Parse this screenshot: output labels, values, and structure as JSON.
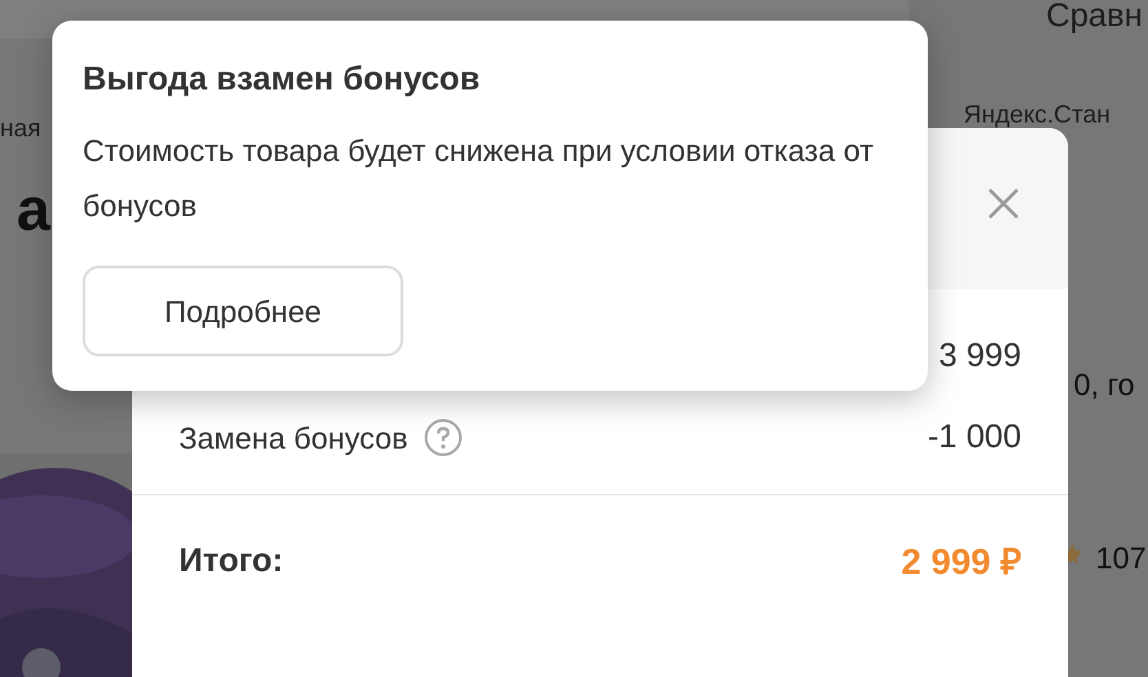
{
  "background": {
    "compare_link": "Сравн",
    "breadcrumb_left": "ная",
    "breadcrumb_right": "Яндекс.Стан",
    "heading": "а",
    "spec_fragment": "0, го",
    "reviews_count": "107"
  },
  "modal": {
    "rows": [
      {
        "value": "3 999"
      },
      {
        "label": "Замена бонусов",
        "value": "-1 000",
        "help": true
      }
    ],
    "total": {
      "label": "Итого:",
      "value": "2 999 ₽"
    }
  },
  "tooltip": {
    "title": "Выгода взамен бонусов",
    "text": "Стоимость товара будет снижена при условии отказа от бонусов",
    "button": "Подробнее"
  }
}
